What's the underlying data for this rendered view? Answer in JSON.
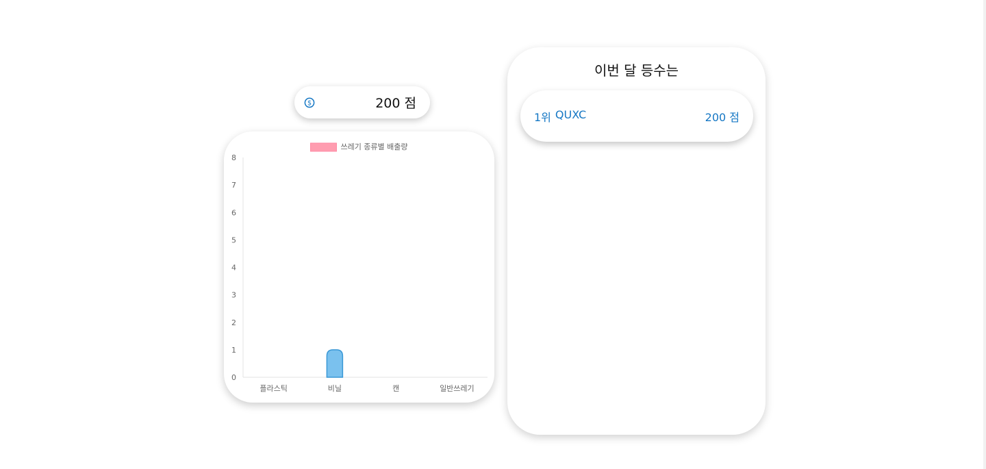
{
  "points": {
    "icon": "coin-icon",
    "value": "200 점"
  },
  "chart_data": {
    "type": "bar",
    "legend": "쓰레기 종류별 배출량",
    "categories": [
      "플라스틱",
      "비닐",
      "캔",
      "일반쓰레기"
    ],
    "values": [
      0,
      1,
      0,
      0
    ],
    "ylim": [
      0,
      8
    ],
    "yticks": [
      "0",
      "1",
      "2",
      "3",
      "4",
      "5",
      "6",
      "7",
      "8"
    ],
    "bar_color": "#7ac1ee",
    "bar_border_color": "#3a98d6",
    "legend_color": "#ff9db0",
    "legend_position": "top"
  },
  "ranking": {
    "title": "이번 달 등수는",
    "entries": [
      {
        "rank": "1위",
        "name": "QUXC",
        "score": "200 점"
      }
    ]
  },
  "colors": {
    "accent": "#1577c4"
  }
}
